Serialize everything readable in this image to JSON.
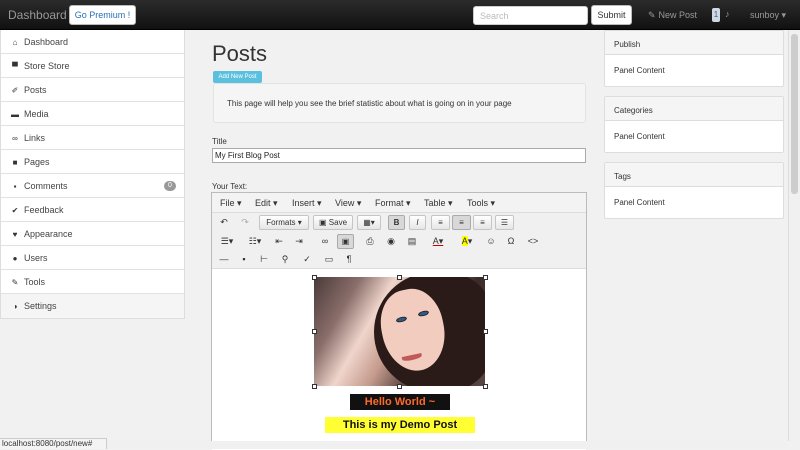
{
  "topbar": {
    "brand": "Dashboard",
    "premium_label": "Go Premium !",
    "search_placeholder": "Search",
    "submit_label": "Submit",
    "new_post_label": "New Post",
    "badge_count": "1",
    "user_label": "sunboy ▾"
  },
  "sidebar": {
    "items": [
      {
        "label": "Dashboard",
        "icon": "home-icon"
      },
      {
        "label": "Store Store",
        "icon": "cart-icon"
      },
      {
        "label": "Posts",
        "icon": "pushpin-icon"
      },
      {
        "label": "Media",
        "icon": "media-icon"
      },
      {
        "label": "Links",
        "icon": "link-icon"
      },
      {
        "label": "Pages",
        "icon": "pages-icon"
      },
      {
        "label": "Comments",
        "icon": "comment-icon",
        "count": "0"
      },
      {
        "label": "Feedback",
        "icon": "check-icon"
      },
      {
        "label": "Appearance",
        "icon": "heart-icon"
      },
      {
        "label": "Users",
        "icon": "user-icon"
      },
      {
        "label": "Tools",
        "icon": "wrench-icon"
      },
      {
        "label": "Settings",
        "icon": "settings-icon"
      }
    ]
  },
  "main": {
    "title": "Posts",
    "add_new_label": "Add New Post",
    "info_text": "This page will help you see the brief statistic about what is going on in your page",
    "title_label": "Title",
    "title_value": "My First Blog Post",
    "text_label": "Your Text:"
  },
  "editor": {
    "menus": [
      "File ▾",
      "Edit ▾",
      "Insert ▾",
      "View ▾",
      "Format ▾",
      "Table ▾",
      "Tools ▾"
    ],
    "formats_label": "Formats ▾",
    "save_label": "Save",
    "hello_text": "Hello World ~",
    "demo_text": "This is my Demo Post"
  },
  "panels": [
    {
      "title": "Publish",
      "content": "Panel Content"
    },
    {
      "title": "Categories",
      "content": "Panel Content"
    },
    {
      "title": "Tags",
      "content": "Panel Content"
    }
  ],
  "status": {
    "url": "localhost:8080/post/new#"
  }
}
